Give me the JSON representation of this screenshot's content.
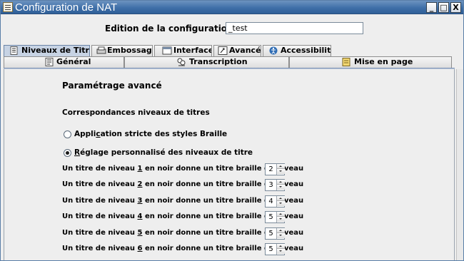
{
  "window": {
    "title": "Configuration de NAT",
    "minimize_glyph": "_",
    "maximize_glyph": "□",
    "close_glyph": "X"
  },
  "header": {
    "config_label": "Edition de la configuration :",
    "config_value": "_test"
  },
  "tabs_row1": [
    {
      "label": "Niveaux de Titres",
      "icon": "document-icon",
      "selected": true
    },
    {
      "label": "Embossage",
      "icon": "embosser-icon"
    },
    {
      "label": "Interface",
      "icon": "window-icon"
    },
    {
      "label": "Avancé",
      "icon": "advanced-icon"
    },
    {
      "label": "Accessibilité",
      "icon": "accessibility-icon"
    }
  ],
  "tabs_row2": [
    {
      "label": "Général",
      "icon": "general-icon"
    },
    {
      "label": "Transcription",
      "icon": "transcription-icon"
    },
    {
      "label": "Mise en page",
      "icon": "layout-icon"
    }
  ],
  "content": {
    "section_title": "Paramétrage avancé",
    "subtitle": "Correspondances niveaux de titres",
    "radio_strict": {
      "pre": "Appli",
      "u": "c",
      "post": "ation stricte des styles Braille",
      "checked": false
    },
    "radio_custom": {
      "pre": "",
      "u": "R",
      "post": "églage personnalisé des niveaux de titre",
      "checked": true
    },
    "levels": [
      {
        "pre": "Un titre de niveau ",
        "num": "1",
        "post": " en noir donne un titre braille de niveau",
        "value": "2"
      },
      {
        "pre": "Un titre de niveau ",
        "num": "2",
        "post": " en noir donne un titre braille de niveau",
        "value": "3"
      },
      {
        "pre": "Un titre de niveau ",
        "num": "3",
        "post": " en noir donne un titre braille de niveau",
        "value": "4"
      },
      {
        "pre": "Un titre de niveau ",
        "num": "4",
        "post": " en noir donne un titre braille de niveau",
        "value": "5"
      },
      {
        "pre": "Un titre de niveau ",
        "num": "5",
        "post": " en noir donne un titre braille de niveau",
        "value": "5"
      },
      {
        "pre": "Un titre de niveau ",
        "num": "6",
        "post": " en noir donne un titre braille de niveau",
        "value": "5"
      }
    ]
  }
}
